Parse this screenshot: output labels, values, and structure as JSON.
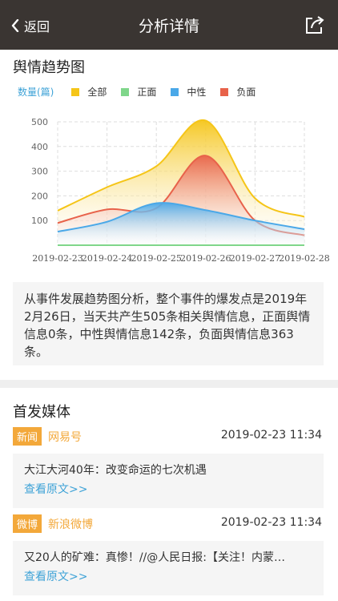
{
  "nav": {
    "back_label": "返回",
    "title": "分析详情"
  },
  "trend": {
    "section_title": "舆情趋势图",
    "summary": "从事件发展趋势图分析，整个事件的爆发点是2019年2月26日，当天共产生505条相关舆情信息，正面舆情信息0条，中性舆情信息142条，负面舆情信息363条。"
  },
  "chart_data": {
    "type": "area",
    "ylabel": "数量(篇)",
    "x": [
      "2019-02-23",
      "2019-02-24",
      "2019-02-25",
      "2019-02-26",
      "2019-02-27",
      "2019-02-28"
    ],
    "ylim": [
      0,
      500
    ],
    "yticks": [
      100,
      200,
      300,
      400,
      500
    ],
    "grid": true,
    "legend_position": "top",
    "series": [
      {
        "name": "全部",
        "color": "#f5c518",
        "values": [
          140,
          235,
          320,
          505,
          190,
          115
        ]
      },
      {
        "name": "正面",
        "color": "#7fd68a",
        "values": [
          0,
          0,
          0,
          0,
          0,
          0
        ]
      },
      {
        "name": "中性",
        "color": "#4aa8e8",
        "values": [
          55,
          95,
          170,
          142,
          100,
          65
        ]
      },
      {
        "name": "负面",
        "color": "#e8624a",
        "values": [
          90,
          145,
          150,
          363,
          100,
          40
        ]
      }
    ]
  },
  "media": {
    "section_title": "首发媒体",
    "items": [
      {
        "type": "新闻",
        "source": "网易号",
        "time": "2019-02-23 11:34",
        "headline": "大江大河40年：改变命运的七次机遇",
        "link": "查看原文>>"
      },
      {
        "type": "微博",
        "source": "新浪微博",
        "time": "2019-02-23 11:34",
        "headline": "又20人的矿难：真惨！//@人民日报:【关注！内蒙…",
        "link": "查看原文>>"
      }
    ]
  }
}
